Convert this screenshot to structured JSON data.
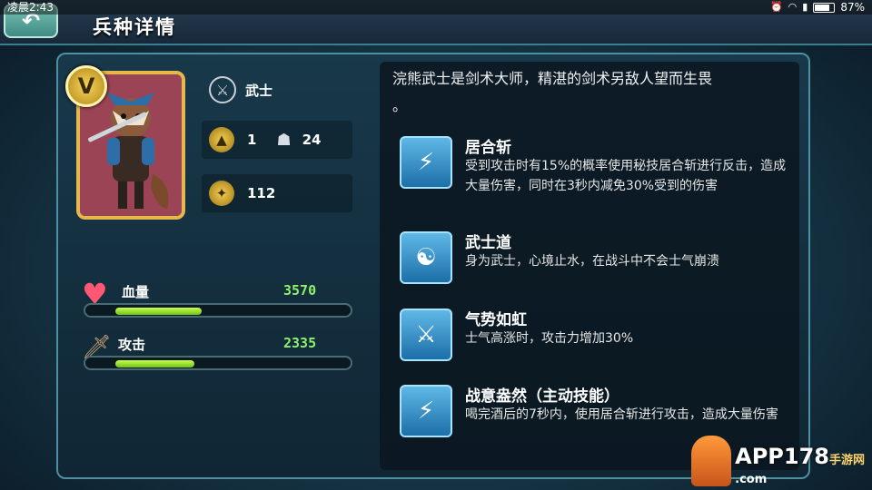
{
  "status_bar": {
    "time": "凌晨2:43",
    "battery": "87%",
    "battery_level": 0.87
  },
  "header": {
    "title": "兵种详情",
    "back_icon": "back-arrow-icon"
  },
  "unit": {
    "rank": "V",
    "type_label": "武士",
    "cost": "1",
    "troops": "24",
    "power": "112"
  },
  "stats": {
    "hp": {
      "label": "血量",
      "value": "3570",
      "fill": 0.37
    },
    "attack": {
      "label": "攻击",
      "value": "2335",
      "fill": 0.34
    }
  },
  "description": {
    "text_line1": "浣熊武士是剑术大师，精湛的剑术另敌人望而生畏",
    "text_line2": "。"
  },
  "skills": [
    {
      "name": "居合斩",
      "desc": "受到攻击时有15%的概率使用秘技居合斩进行反击，造成大量伤害，同时在3秒内减免30%受到的伤害",
      "icon": "slash-icon"
    },
    {
      "name": "武士道",
      "desc": "身为武士，心境止水，在战斗中不会士气崩溃",
      "icon": "raccoon-mask-icon"
    },
    {
      "name": "气势如虹",
      "desc": "士气高涨时，攻击力增加30%",
      "icon": "crossed-swords-up-icon"
    },
    {
      "name": "战意盎然（主动技能）",
      "desc": "喝完酒后的7秒内，使用居合斩进行攻击，造成大量伤害",
      "icon": "slash-icon"
    }
  ],
  "watermark": {
    "text": "APP178",
    "sub": "手游网",
    "suffix": ".com"
  },
  "colors": {
    "accent": "#4e8fa0",
    "stat_value": "#8ef06c",
    "bar_fill": "#a6f236",
    "gold": "#e4b84b"
  }
}
